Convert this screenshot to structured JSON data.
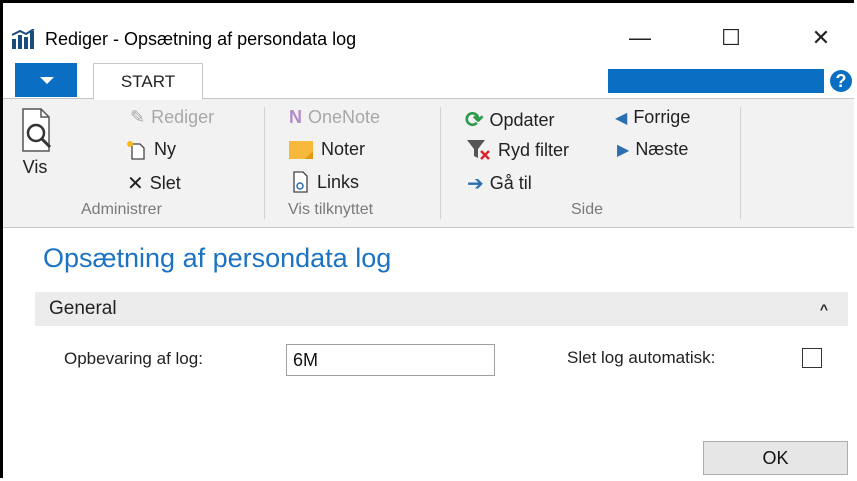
{
  "window": {
    "title": "Rediger - Opsætning af persondata log",
    "minimize_label": "—",
    "maximize_label": "☐",
    "close_label": "✕"
  },
  "ribbon_tabs": {
    "start_label": "START",
    "help_label": "?"
  },
  "ribbon": {
    "groups": {
      "administrer": "Administrer",
      "vis_tilknyttet": "Vis tilknyttet",
      "side": "Side"
    },
    "buttons": {
      "vis": "Vis",
      "rediger": "Rediger",
      "ny": "Ny",
      "slet": "Slet",
      "onenote": "OneNote",
      "noter": "Noter",
      "links": "Links",
      "opdater": "Opdater",
      "ryd_filter": "Ryd filter",
      "gaa_til": "Gå til",
      "forrige": "Forrige",
      "naeste": "Næste"
    }
  },
  "page": {
    "title": "Opsætning af persondata log",
    "section_title": "General",
    "fields": {
      "retention_label": "Opbevaring af log:",
      "retention_value": "6M",
      "auto_delete_label": "Slet log automatisk:",
      "auto_delete_checked": false
    },
    "ok_label": "OK"
  },
  "colors": {
    "accent": "#0a6fc2",
    "title_blue": "#1c73c3"
  }
}
